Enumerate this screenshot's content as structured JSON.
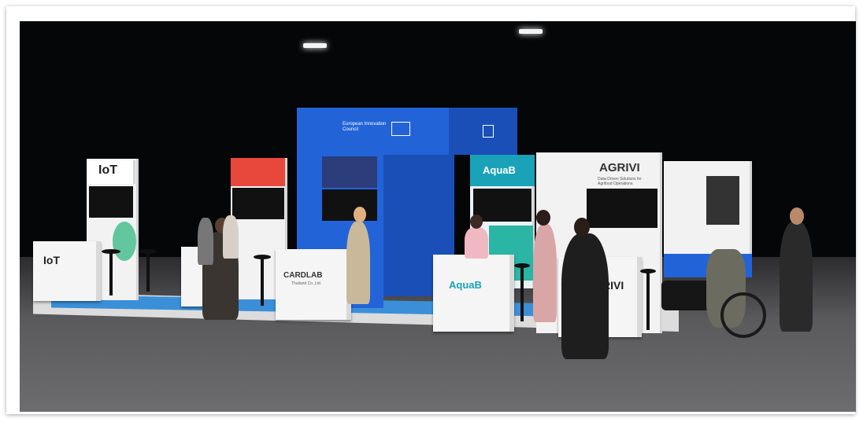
{
  "booths": {
    "iot_sign": "IoT",
    "iot_counter": "IoT",
    "cardlab_name": "CARDLAB",
    "cardlab_sub": "Thailand Co.,Ltd.",
    "aquab_sign": "AquaB",
    "aquab_counter": "AquaB",
    "agrivi_name": "AGRIVI",
    "agrivi_tagline": "Data-Driven Solutions for Agrifood Operations",
    "agrivi_counter": "RIVI",
    "eic_banner": "European Innovation Council"
  },
  "colors": {
    "accent_blue": "#2363d8",
    "aquab_teal": "#1aa3b8",
    "agrivi_green": "#3dbb88"
  }
}
